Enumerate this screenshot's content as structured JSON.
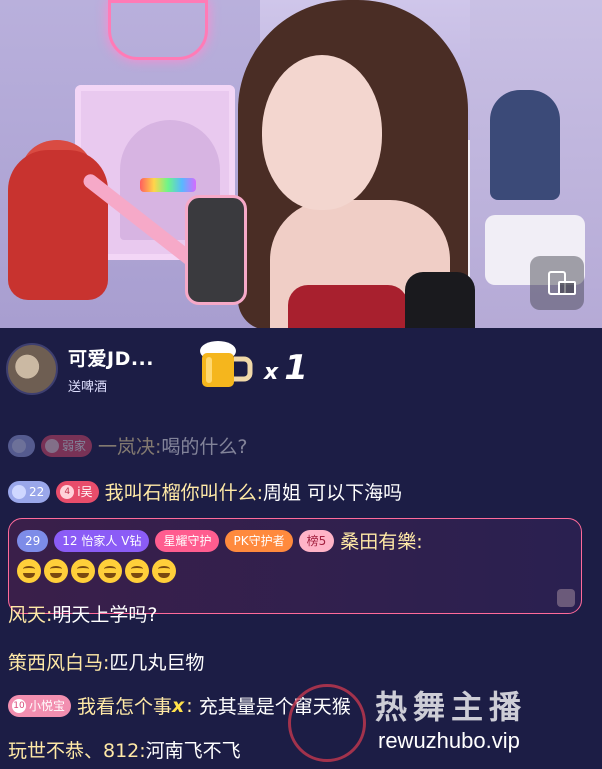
{
  "gift_banner": {
    "sender_name": "可爱JD...",
    "action": "送啤酒",
    "multiplier_x": "x",
    "multiplier_count": "1",
    "gift_icon": "beer-mug-icon"
  },
  "chat": [
    {
      "fans_level": "",
      "fan_club": "弱家",
      "user": "一岚决:",
      "text": "喝的什么?"
    },
    {
      "fans_level": "22",
      "fan_club_level": "4",
      "fan_club": "i吴",
      "user": "我叫石榴你叫什么:",
      "text": "周姐 可以下海吗"
    },
    {
      "highlighted": true,
      "badges": [
        "29",
        "12",
        "怡家人",
        "V钻",
        "星耀守护",
        "PK守护者",
        "榜5"
      ],
      "user": "桑田有樂:",
      "emoji_count": 6
    },
    {
      "user": "风天:",
      "text": "明天上学吗?"
    },
    {
      "user": "策西风白马:",
      "text": "匹几丸巨物"
    },
    {
      "fan_club_level": "10",
      "fan_club": "小悦宝",
      "user": "我看怎个事",
      "text": "充其量是个窜天猴"
    },
    {
      "user": "玩世不恭、812:",
      "text": "河南飞不飞"
    }
  ],
  "watermark": {
    "title": "热舞主播",
    "url": "rewuzhubo.vip"
  },
  "colors": {
    "chat_background": "#1c1d45",
    "username": "#ffe9a6",
    "highlight_border": "#ff6a9a"
  }
}
